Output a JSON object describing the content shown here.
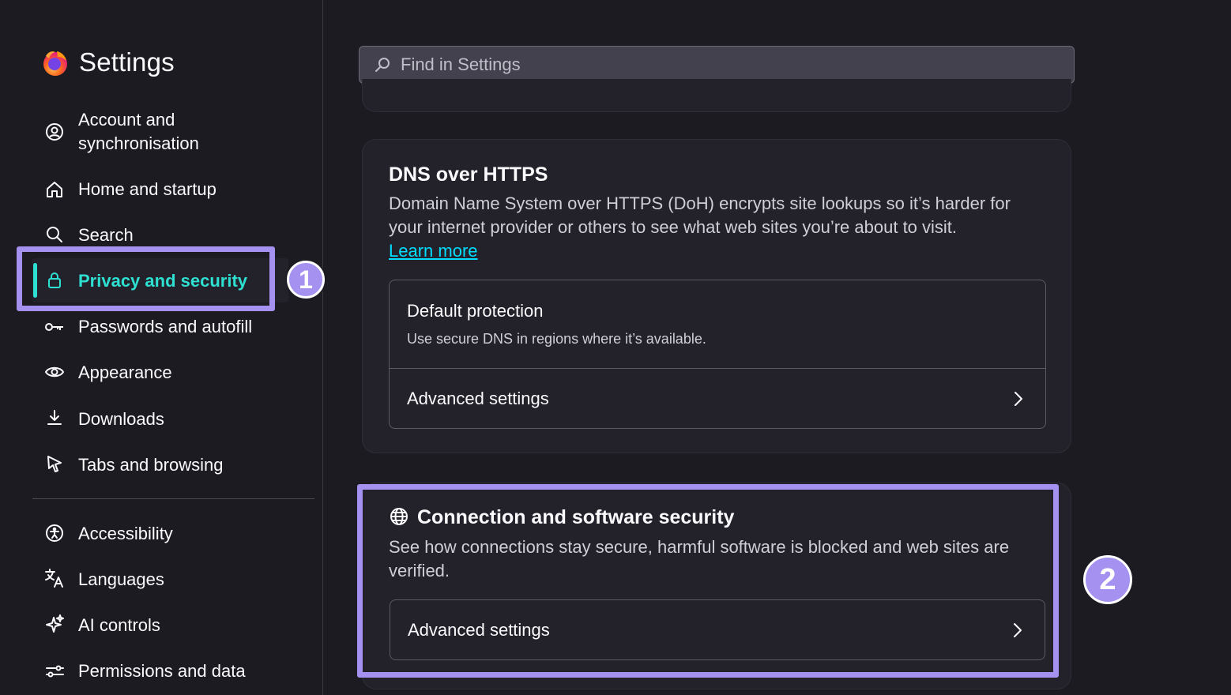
{
  "app": {
    "title": "Settings"
  },
  "sidebar": {
    "items": [
      {
        "label": "Account and\nsynchronisation",
        "icon": "account-icon"
      },
      {
        "label": "Home and startup",
        "icon": "home-icon"
      },
      {
        "label": "Search",
        "icon": "search-icon"
      },
      {
        "label": "Privacy and security",
        "icon": "lock-icon",
        "active": true
      },
      {
        "label": "Passwords and autofill",
        "icon": "key-icon"
      },
      {
        "label": "Appearance",
        "icon": "eye-icon"
      },
      {
        "label": "Downloads",
        "icon": "download-icon"
      },
      {
        "label": "Tabs and browsing",
        "icon": "cursor-icon"
      },
      {
        "label": "Accessibility",
        "icon": "accessibility-icon"
      },
      {
        "label": "Languages",
        "icon": "translate-icon"
      },
      {
        "label": "AI controls",
        "icon": "sparkle-icon"
      },
      {
        "label": "Permissions and data",
        "icon": "permissions-icon"
      }
    ]
  },
  "search": {
    "placeholder": "Find in Settings"
  },
  "dns": {
    "title": "DNS over HTTPS",
    "description": "Domain Name System over HTTPS (DoH) encrypts site lookups so it’s harder for your internet provider or others to see what web sites you’re about to visit.",
    "learn_more": "Learn more",
    "default_title": "Default protection",
    "default_sub": "Use secure DNS in regions where it’s available.",
    "advanced": "Advanced settings"
  },
  "connection": {
    "title": "Connection and software security",
    "description": "See how connections stay secure, harmful software is blocked and web sites are verified.",
    "advanced": "Advanced settings"
  },
  "annotations": {
    "badge1": "1",
    "badge2": "2"
  },
  "colors": {
    "accent": "#2ee0d1",
    "highlight": "#a491f0",
    "link": "#00ddff",
    "background": "#1c1b22",
    "card": "#23222b"
  }
}
